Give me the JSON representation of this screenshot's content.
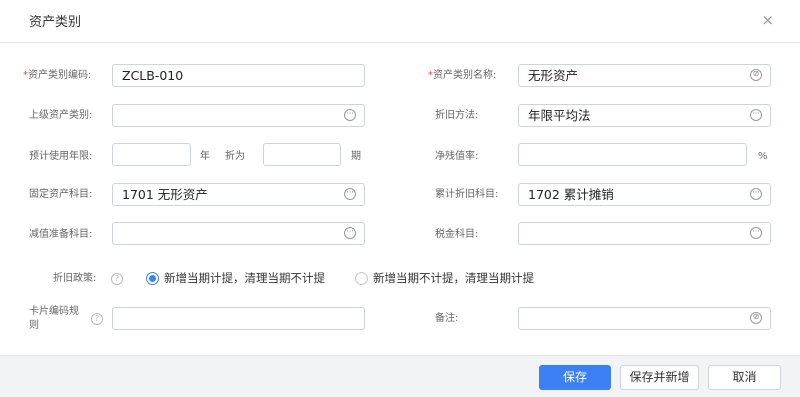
{
  "dialog": {
    "title": "资产类别",
    "close_glyph": "×"
  },
  "form": {
    "code": {
      "required_mark": "*",
      "label": "资产类别编码:",
      "value": "ZCLB-010"
    },
    "name": {
      "required_mark": "*",
      "label": "资产类别名称:",
      "value": "无形资产"
    },
    "parent": {
      "label": "上级资产类别:",
      "value": ""
    },
    "method": {
      "label": "折旧方法:",
      "value": "年限平均法"
    },
    "life": {
      "label": "预计使用年限:",
      "years_value": "",
      "years_unit": "年",
      "discount_label": "折为",
      "months_value": "",
      "months_unit": "期"
    },
    "residual": {
      "label": "净残值率:",
      "value": "",
      "unit": "%"
    },
    "asset_account": {
      "label": "固定资产科目:",
      "value": "1701 无形资产"
    },
    "dep_account": {
      "label": "累计折旧科目:",
      "value": "1702 累计摊销"
    },
    "impair_account": {
      "label": "减值准备科目:",
      "value": ""
    },
    "tax_account": {
      "label": "税金科目:",
      "value": ""
    },
    "policy": {
      "label": "折旧政策:",
      "options": [
        {
          "label": "新增当期计提，清理当期不计提",
          "checked": true
        },
        {
          "label": "新增当期不计提，清理当期计提",
          "checked": false
        }
      ]
    },
    "card_rule": {
      "label_line1": "卡片编码规",
      "label_line2": "则",
      "value": ""
    },
    "remark": {
      "label": "备注:",
      "value": ""
    }
  },
  "icons": {
    "ellipsis": "···",
    "lookup": "⊘",
    "help": "?"
  },
  "colors": {
    "primary": "#3d7ff5",
    "required": "#e8463a",
    "radio_checked": "#3b82f6"
  },
  "footer": {
    "save_label": "保存",
    "save_new_label": "保存并新增",
    "cancel_label": "取消"
  }
}
